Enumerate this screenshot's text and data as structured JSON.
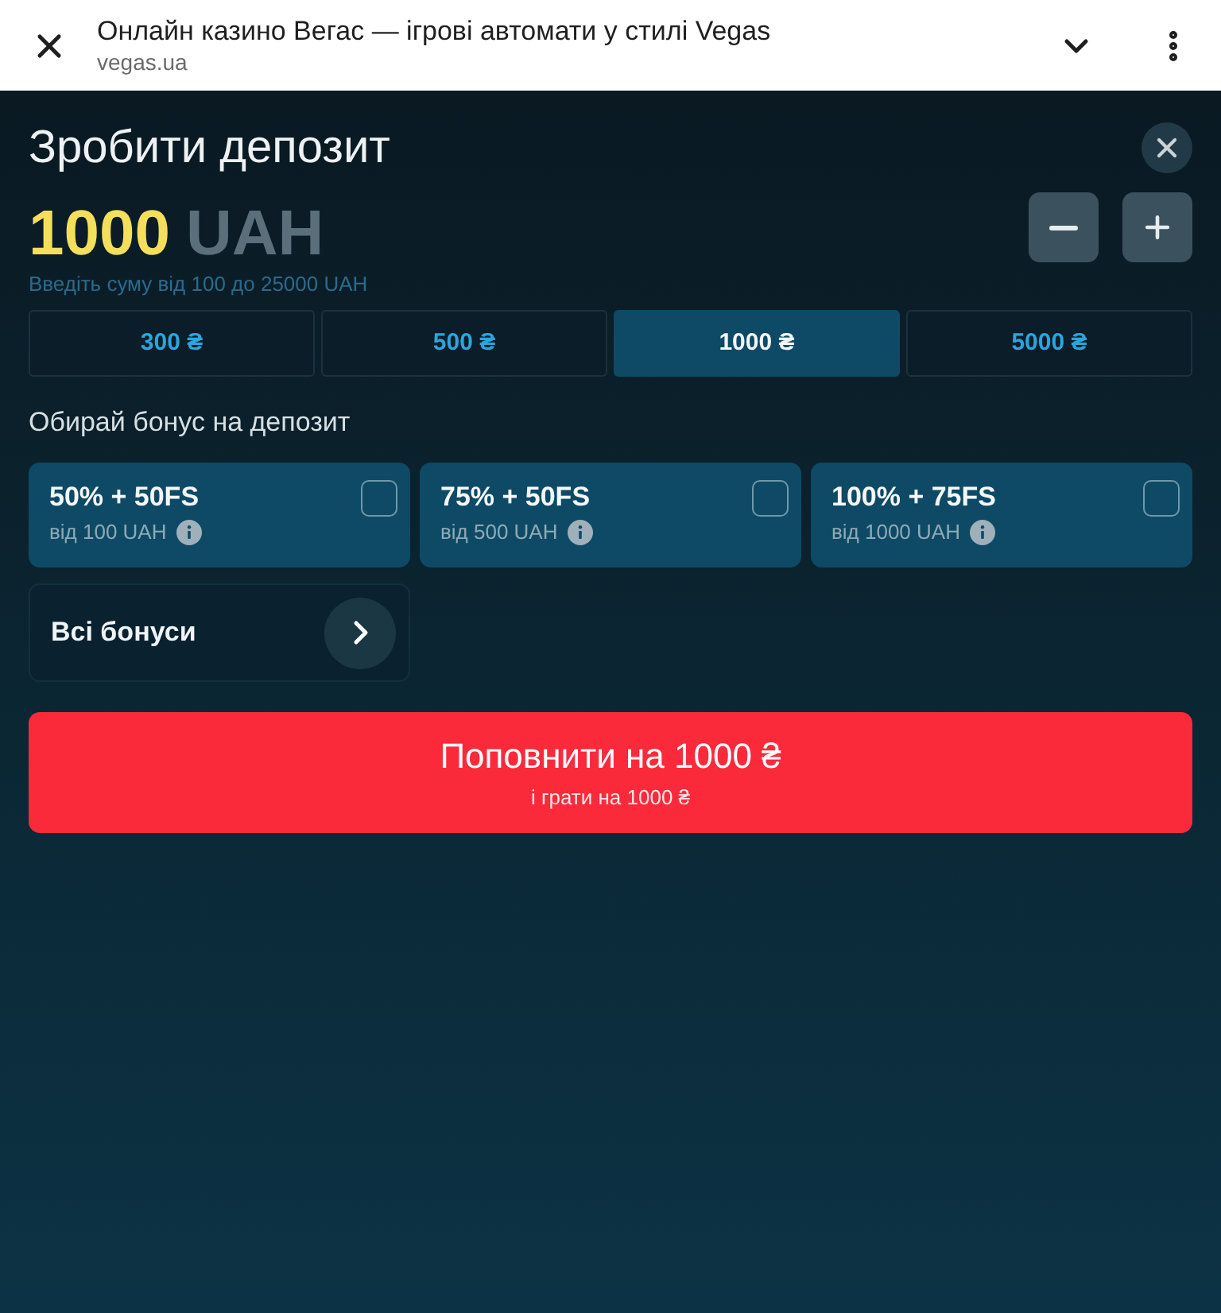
{
  "browser_bar": {
    "title": "Онлайн казино Вегас — ігрові автомати у стилі Vegas",
    "url": "vegas.ua"
  },
  "dialog": {
    "title": "Зробити депозит",
    "amount": "1000",
    "currency": "UAH",
    "hint": "Введіть суму від 100 до 25000 UAH"
  },
  "presets": [
    {
      "label": "300 ₴",
      "selected": false
    },
    {
      "label": "500 ₴",
      "selected": false
    },
    {
      "label": "1000 ₴",
      "selected": true
    },
    {
      "label": "5000 ₴",
      "selected": false
    }
  ],
  "bonus_heading": "Обирай бонус на депозит",
  "bonuses": [
    {
      "title": "50% + 50FS",
      "minimum": "від 100 UAH",
      "checked": false
    },
    {
      "title": "75% + 50FS",
      "minimum": "від 500 UAH",
      "checked": false
    },
    {
      "title": "100% + 75FS",
      "minimum": "від 1000 UAH",
      "checked": false
    }
  ],
  "all_bonuses": {
    "label": "Всі бонуси"
  },
  "submit": {
    "label": "Поповнити на 1000 ₴",
    "sublabel": "і грати на 1000 ₴"
  }
}
